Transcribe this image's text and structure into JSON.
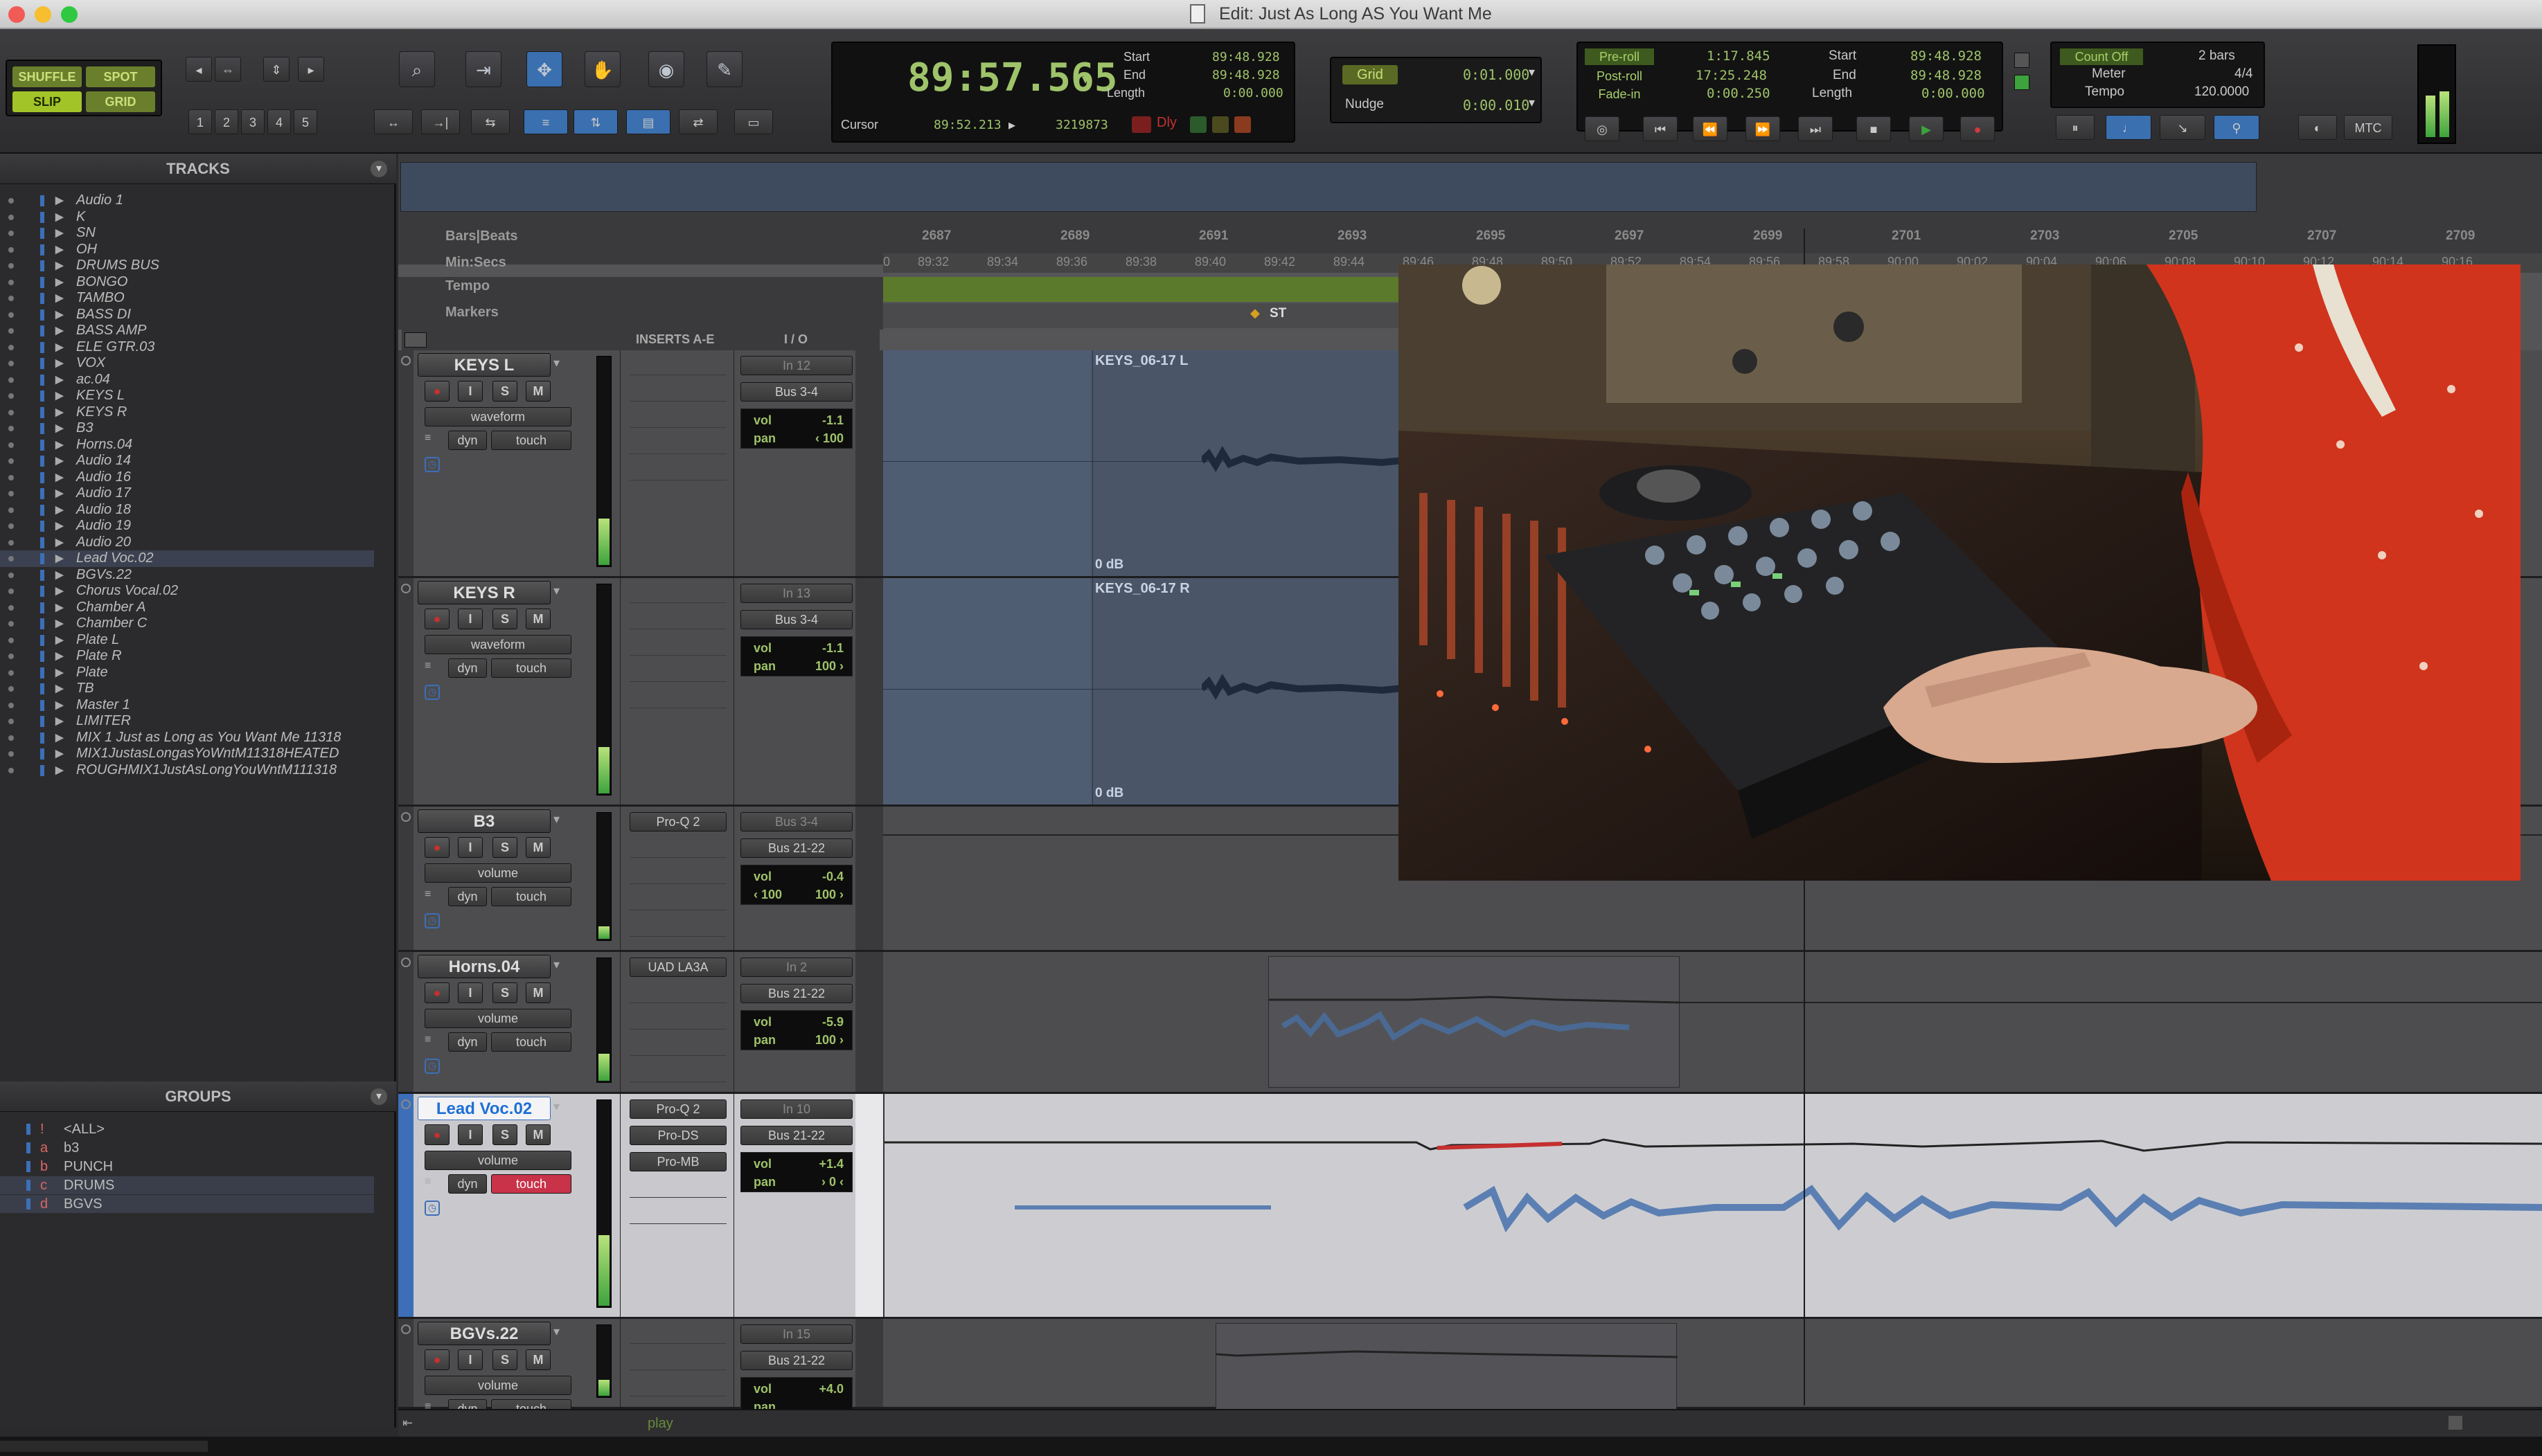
{
  "window": {
    "title": "Edit: Just As Long AS You Want Me"
  },
  "toolbar": {
    "modes": {
      "shuffle": "SHUFFLE",
      "spot": "SPOT",
      "slip": "SLIP",
      "grid": "GRID"
    },
    "zoom_presets": [
      "1",
      "2",
      "3",
      "4",
      "5"
    ],
    "main_counter": "89:57.565",
    "cursor_label": "Cursor",
    "cursor_value": "89:52.213",
    "cursor_sample": "3219873",
    "sel": {
      "start_label": "Start",
      "start": "89:48.928",
      "end_label": "End",
      "end": "89:48.928",
      "length_label": "Length",
      "length": "0:00.000"
    },
    "grid_label": "Grid",
    "grid_value": "0:01.000",
    "nudge_label": "Nudge",
    "nudge_value": "0:00.010",
    "preroll_label": "Pre-roll",
    "preroll": "1:17.845",
    "postroll_label": "Post-roll",
    "postroll": "17:25.248",
    "fadein_label": "Fade-in",
    "fadein": "0:00.250",
    "sel2": {
      "start_label": "Start",
      "start": "89:48.928",
      "end_label": "End",
      "end": "89:48.928",
      "length_label": "Length",
      "length": "0:00.000"
    },
    "countoff": "Count Off",
    "countoff_value": "2 bars",
    "meter_label": "Meter",
    "meter_value": "4/4",
    "tempo_label": "Tempo",
    "tempo_value": "120.0000",
    "dly": "Dly",
    "mtc": "MTC"
  },
  "tracks_panel": {
    "title": "TRACKS",
    "items": [
      "Audio 1",
      "K",
      "SN",
      "OH",
      "DRUMS BUS",
      "BONGO",
      "TAMBO",
      "BASS DI",
      "BASS AMP",
      "ELE GTR.03",
      "VOX",
      "ac.04",
      "KEYS L",
      "KEYS R",
      "B3",
      "Horns.04",
      "Audio 14",
      "Audio 16",
      "Audio 17",
      "Audio 18",
      "Audio 19",
      "Audio 20",
      "Lead Voc.02",
      "BGVs.22",
      "Chorus Vocal.02",
      "Chamber A",
      "Chamber C",
      "Plate L",
      "Plate R",
      "Plate",
      "TB",
      "Master 1",
      "LIMITER",
      "MIX 1 Just as Long as You Want Me 11318",
      "MIX1JustasLongasYoWntM11318HEATED",
      "ROUGHMIX1JustAsLongYouWntM111318"
    ]
  },
  "groups_panel": {
    "title": "GROUPS",
    "items": [
      {
        "id": "!",
        "name": "<ALL>"
      },
      {
        "id": "a",
        "name": "b3"
      },
      {
        "id": "b",
        "name": "PUNCH"
      },
      {
        "id": "c",
        "name": "DRUMS"
      },
      {
        "id": "d",
        "name": "BGVS"
      }
    ]
  },
  "rulers": {
    "bars_label": "Bars|Beats",
    "minsecs_label": "Min:Secs",
    "tempo_label": "Tempo",
    "markers_label": "Markers",
    "marker_name": "ST",
    "bars": [
      "2687",
      "2689",
      "2691",
      "2693",
      "2695",
      "2697",
      "2699",
      "2701",
      "2703",
      "2705",
      "2707",
      "2709"
    ],
    "mins": [
      "0",
      "89:32",
      "89:34",
      "89:36",
      "89:38",
      "89:40",
      "89:42",
      "89:44",
      "89:46",
      "89:48",
      "89:50",
      "89:52",
      "89:54",
      "89:56",
      "89:58",
      "90:00",
      "90:02",
      "90:04",
      "90:06",
      "90:08",
      "90:10",
      "90:12",
      "90:14",
      "90:16"
    ]
  },
  "column_headers": {
    "inserts": "INSERTS A-E",
    "io": "I / O"
  },
  "tracks": [
    {
      "name": "KEYS L",
      "view": "waveform",
      "dyn": "dyn",
      "automation": "touch",
      "in": "In 12",
      "out": "Bus 3-4",
      "vol_label": "vol",
      "vol": "-1.1",
      "pan_label": "pan",
      "pan": "‹ 100",
      "clip": "KEYS_06-17 L",
      "db": "0 dB",
      "inserts": []
    },
    {
      "name": "KEYS R",
      "view": "waveform",
      "dyn": "dyn",
      "automation": "touch",
      "in": "In 13",
      "out": "Bus 3-4",
      "vol_label": "vol",
      "vol": "-1.1",
      "pan_label": "pan",
      "pan": "100 ›",
      "clip": "KEYS_06-17 R",
      "db": "0 dB",
      "inserts": []
    },
    {
      "name": "B3",
      "view": "volume",
      "dyn": "dyn",
      "automation": "touch",
      "in": "Bus 3-4",
      "out": "Bus 21-22",
      "vol_label": "vol",
      "vol": "-0.4",
      "pan_label": "‹ 100",
      "pan": "100 ›",
      "inserts": [
        "Pro-Q 2"
      ]
    },
    {
      "name": "Horns.04",
      "view": "volume",
      "dyn": "dyn",
      "automation": "touch",
      "in": "In 2",
      "out": "Bus 21-22",
      "vol_label": "vol",
      "vol": "-5.9",
      "pan_label": "pan",
      "pan": "100 ›",
      "inserts": [
        "UAD LA3A"
      ]
    },
    {
      "name": "Lead Voc.02",
      "view": "volume",
      "dyn": "dyn",
      "automation": "touch",
      "in": "In 10",
      "out": "Bus 21-22",
      "vol_label": "vol",
      "vol": "+1.4",
      "pan_label": "pan",
      "pan": "› 0 ‹",
      "inserts": [
        "Pro-Q 2",
        "Pro-DS",
        "Pro-MB"
      ]
    },
    {
      "name": "BGVs.22",
      "view": "volume",
      "dyn": "dyn",
      "automation": "touch",
      "in": "In 15",
      "out": "Bus 21-22",
      "vol_label": "vol",
      "vol": "+4.0",
      "pan_label": "pan",
      "pan": "",
      "inserts": []
    }
  ],
  "buttons": {
    "rec": "●",
    "input": "I",
    "solo": "S",
    "mute": "M"
  },
  "status": {
    "play": "play"
  },
  "colors": {
    "accent_blue": "#3c6fb8",
    "lcd_green": "#9fc36a",
    "record_red": "#c53030",
    "selected_track": "#d8d8dc"
  }
}
